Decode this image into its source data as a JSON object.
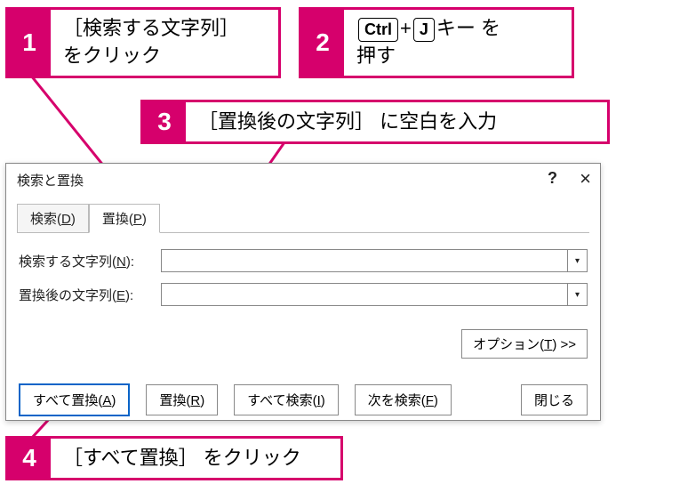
{
  "callouts": {
    "c1": {
      "num": "1",
      "line1": "［検索する文字列］",
      "line2": "をクリック"
    },
    "c2": {
      "num": "2",
      "key1": "Ctrl",
      "plus": "+",
      "key2": "J",
      "tail": "キー を",
      "line2": "押す"
    },
    "c3": {
      "num": "3",
      "text": "［置換後の文字列］ に空白を入力"
    },
    "c4": {
      "num": "4",
      "text": "［すべて置換］ をクリック"
    }
  },
  "dialog": {
    "title": "検索と置換",
    "help": "?",
    "close": "×",
    "tabs": {
      "find": "検索(D)",
      "replace": "置換(P)"
    },
    "fields": {
      "find_label": "検索する文字列(N):",
      "find_value": "",
      "replace_label": "置換後の文字列(E):",
      "replace_value": ""
    },
    "options_btn": "オプション(T) >>",
    "buttons": {
      "replace_all": "すべて置換(A)",
      "replace": "置換(R)",
      "find_all": "すべて検索(I)",
      "find_next": "次を検索(F)",
      "close": "閉じる"
    }
  }
}
